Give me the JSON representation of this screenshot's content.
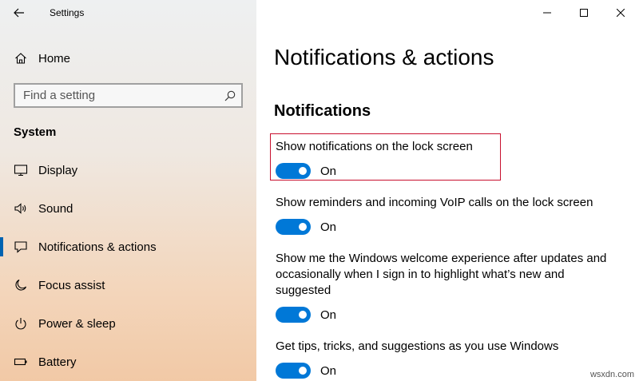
{
  "window": {
    "title": "Settings"
  },
  "sidebar": {
    "home_label": "Home",
    "search": {
      "placeholder": "Find a setting",
      "value": ""
    },
    "section_title": "System",
    "items": [
      {
        "label": "Display",
        "icon": "monitor-icon"
      },
      {
        "label": "Sound",
        "icon": "speaker-icon"
      },
      {
        "label": "Notifications & actions",
        "icon": "message-icon",
        "selected": true
      },
      {
        "label": "Focus assist",
        "icon": "moon-icon"
      },
      {
        "label": "Power & sleep",
        "icon": "power-icon"
      },
      {
        "label": "Battery",
        "icon": "battery-icon"
      }
    ]
  },
  "main": {
    "page_title": "Notifications & actions",
    "group_title": "Notifications",
    "settings": [
      {
        "description": "Show notifications on the lock screen",
        "state": "On"
      },
      {
        "description": "Show reminders and incoming VoIP calls on the lock screen",
        "state": "On"
      },
      {
        "description": "Show me the Windows welcome experience after updates and occasionally when I sign in to highlight what’s new and suggested",
        "state": "On"
      },
      {
        "description": "Get tips, tricks, and suggestions as you use Windows",
        "state": "On"
      }
    ]
  },
  "colors": {
    "accent": "#0078d7",
    "highlight": "#c8102e"
  },
  "watermark": "wsxdn.com"
}
